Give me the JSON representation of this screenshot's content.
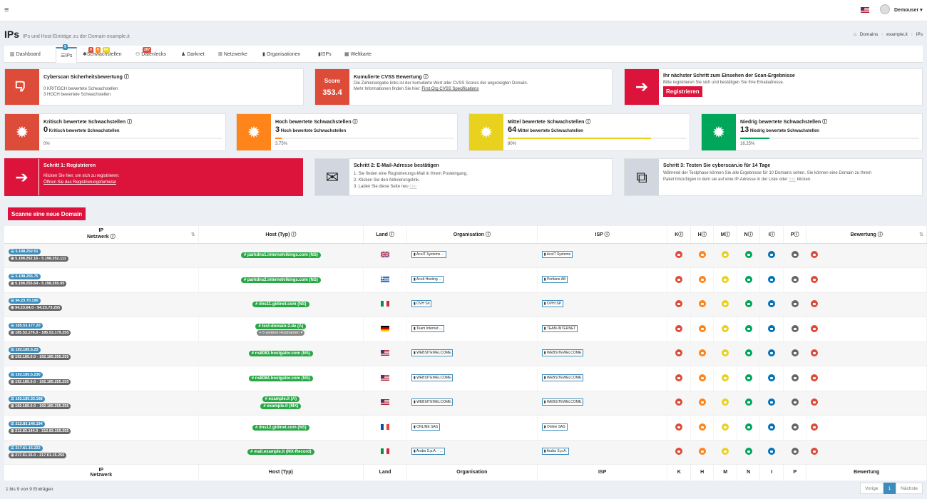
{
  "topbar": {
    "menu_glyph": "≡",
    "user": "Demouser ▾"
  },
  "page": {
    "title": "IPs",
    "subtitle": "IPs und Host-Einträge zu der Domain example.it"
  },
  "breadcrumb": [
    "Domains",
    "example.it",
    "IPs"
  ],
  "tabs": [
    {
      "label": "Dashboard",
      "badge": ""
    },
    {
      "label": "IPs",
      "badge": "9"
    },
    {
      "label": "Schwachstellen",
      "badges": [
        "9",
        "8",
        "64"
      ]
    },
    {
      "label": "Datenlecks",
      "badge": "267"
    },
    {
      "label": "Darknet",
      "badge": ""
    },
    {
      "label": "Netzwerke",
      "badge": ""
    },
    {
      "label": "Organisationen",
      "badge": ""
    },
    {
      "label": "ISPs",
      "badge": ""
    },
    {
      "label": "Weltkarte",
      "badge": ""
    }
  ],
  "cards": {
    "security": {
      "title": "Cyberscan Sicherheitsbewertung",
      "line1": "0 KRITISCH bewertete Schwachstellen",
      "line2": "3 HOCH bewertete Schwachstellen"
    },
    "cvss": {
      "score_label": "Score",
      "score": "353.4",
      "title": "Kumulierte CVSS Bewertung",
      "line1": "Die Zahlenangabe links ist der kumulierte Wert aller CVSS Scores der angezeigten Domain.",
      "line2_prefix": "Mehr Informationen finden Sie hier: ",
      "link": "First.Org CVSS Specifications"
    },
    "next": {
      "title": "Ihr nächster Schritt zum Einsehen der Scan-Ergebnisse",
      "line1": "Bitte registrieren Sie sich und bestätigen Sie Ihre Emailadresse.",
      "button": "Registrieren"
    }
  },
  "severity": [
    {
      "title": "Kritisch bewertete Schwachstellen",
      "count": "0",
      "label": "Kritisch bewertete Schwachstellen",
      "percent": "0%",
      "fill": 0,
      "color": "#dd4b39"
    },
    {
      "title": "Hoch bewertete Schwachstellen",
      "count": "3",
      "label": "Hoch bewertete Schwachstellen",
      "percent": "3.75%",
      "fill": 0.0375,
      "color": "#ff851b"
    },
    {
      "title": "Mittel bewertete Schwachstellen",
      "count": "64",
      "label": "Mittel bewertete Schwachstellen",
      "percent": "80%",
      "fill": 0.8,
      "color": "#e8d21d"
    },
    {
      "title": "Niedrig bewertete Schwachstellen",
      "count": "13",
      "label": "Niedrig bewertete Schwachstellen",
      "percent": "16.25%",
      "fill": 0.1625,
      "color": "#00a65a"
    }
  ],
  "steps": {
    "s1": {
      "title": "Schritt 1: Registrieren",
      "line1": "Klicken Sie hier, um sich zu registrieren:",
      "link": "Öffnen Sie das Registrierungsformular"
    },
    "s2": {
      "title": "Schritt 2: E-Mail-Adresse bestätigen",
      "line1": "1. Sie finden eine Registrierungs-Mail in Ihrem Posteingang.",
      "line2": "2. Klicken Sie den Aktivierungslink.",
      "line3": "3. Laden Sie diese Seite neu",
      "line3_link": "hier"
    },
    "s3": {
      "title": "Schritt 3: Testen Sie cyberscan.io für 14 Tage",
      "line1": "Während der Testphase können Sie alle Ergebnisse für 10 Domains sehen. Sie können eine Domain zu Ihrem",
      "line2": "Paket hinzufügen in dem sie auf eine IP-Adresse in der Liste oder",
      "line2_link": "hier",
      "line2_end": "klicken."
    }
  },
  "scan_button": "Scanne eine neue Domain",
  "table": {
    "headers": {
      "ip": "IP",
      "net": "Netzwerk",
      "host": "Host (Typ)",
      "land": "Land",
      "org": "Organisation",
      "isp": "ISP",
      "k": "K",
      "h": "H",
      "m": "M",
      "n": "N",
      "i": "I",
      "p": "P",
      "bew": "Bewertung"
    },
    "rows": [
      {
        "ip": "5.198.252.51",
        "net": "5.198.252.16 - 5.198.252.111",
        "hosts": [
          "parkdns1.internetvikings.com (NS)"
        ],
        "more": "",
        "flag": "gb",
        "org": "AcuIT Systems ...",
        "isp": "AcuIT Systems"
      },
      {
        "ip": "5.198.255.75",
        "net": "5.198.255.64 - 5.198.255.95",
        "hosts": [
          "parkdns2.internetvikings.com (NS)"
        ],
        "more": "",
        "flag": "gr",
        "org": "AcuIt Hosting ...",
        "isp": "Portlane AB"
      },
      {
        "ip": "94.23.70.190",
        "net": "94.23.64.0 - 94.23.73.255",
        "hosts": [
          "dns11.gidinet.com (NS)"
        ],
        "more": "",
        "flag": "it",
        "org": "OVH Srl",
        "isp": "OVH ISP"
      },
      {
        "ip": "185.53.177.20",
        "net": "185.53.176.0 - 185.53.179.255",
        "hosts": [
          "test-domain-2.de (A)"
        ],
        "more": "+ 5 weitere Hostnamen ▾",
        "flag": "de",
        "org": "Team Internet ...",
        "isp": "TEAM-INTERNET"
      },
      {
        "ip": "192.185.5.23",
        "net": "192.185.0.0 - 192.185.255.255",
        "hosts": [
          "ns8083.hostgator.com (NS)"
        ],
        "more": "",
        "flag": "us",
        "org": "WEBSITEWELCOME.C...",
        "isp": "WEBSITEWELCOME.C..."
      },
      {
        "ip": "192.185.5.230",
        "net": "192.185.0.0 - 192.185.255.255",
        "hosts": [
          "ns8084.hostgator.com (NS)"
        ],
        "more": "",
        "flag": "us",
        "org": "WEBSITEWELCOME.C...",
        "isp": "WEBSITEWELCOME.C..."
      },
      {
        "ip": "192.185.33.198",
        "net": "192.185.0.0 - 192.185.255.255",
        "hosts": [
          "example.it (A)",
          "example.it (MX)"
        ],
        "more": "",
        "flag": "us",
        "org": "WEBSITEWELCOME.C...",
        "isp": "WEBSITEWELCOME.C..."
      },
      {
        "ip": "212.83.146.194",
        "net": "212.83.144.0 - 212.83.159.255",
        "hosts": [
          "dns12.gidinet.com (NS)"
        ],
        "more": "",
        "flag": "fr",
        "org": "ONLINE SAS",
        "isp": "Online SAS"
      },
      {
        "ip": "217.61.15.222",
        "net": "217.61.15.0 - 217.61.15.255",
        "hosts": [
          "mail.example.it (MX-Record)"
        ],
        "more": "",
        "flag": "it",
        "org": "Aruba S.p.A. - ...",
        "isp": "Aruba S.p.A."
      }
    ]
  },
  "colors": {
    "k": "#dd4b39",
    "h": "#ff851b",
    "m": "#e8d21d",
    "n": "#00a65a",
    "i": "#0073b7",
    "p": "#666666",
    "bew": "#dd4b39"
  },
  "footer": {
    "info": "1 bis 9 von 9 Einträgen",
    "prev": "Vorige",
    "page": "1",
    "next": "Nächste"
  }
}
